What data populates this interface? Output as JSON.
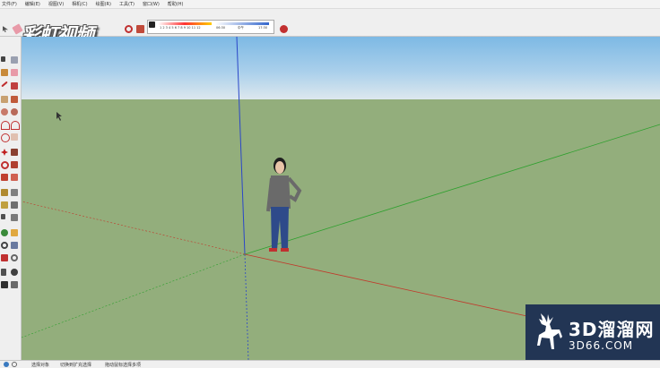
{
  "menubar": {
    "items": [
      "文件(F)",
      "编辑(E)",
      "视图(V)",
      "相机(C)",
      "绘图(R)",
      "工具(T)",
      "窗口(W)",
      "帮助(H)"
    ]
  },
  "watermark": {
    "logo_text": "彩虹视频"
  },
  "toolbar": {
    "scale_numbers": "1 2 3 4 5 6 7 8 9 10 11 12",
    "left_value": "06:30",
    "mid_value": "中午",
    "right_value": "17:30"
  },
  "statusbar": {
    "items": [
      "选择对象",
      "切换到扩充选择",
      "拖动鼠标选择多项"
    ]
  },
  "badge": {
    "title": "3D溜溜网",
    "subtitle": "3D66.COM"
  },
  "colors": {
    "sky_top": "#7db9e4",
    "sky_bottom": "#dde8ee",
    "ground": "#93ae7c",
    "blue_axis": "#2b47c8",
    "green_axis": "#2ea02e",
    "red_axis": "#c1392b"
  }
}
